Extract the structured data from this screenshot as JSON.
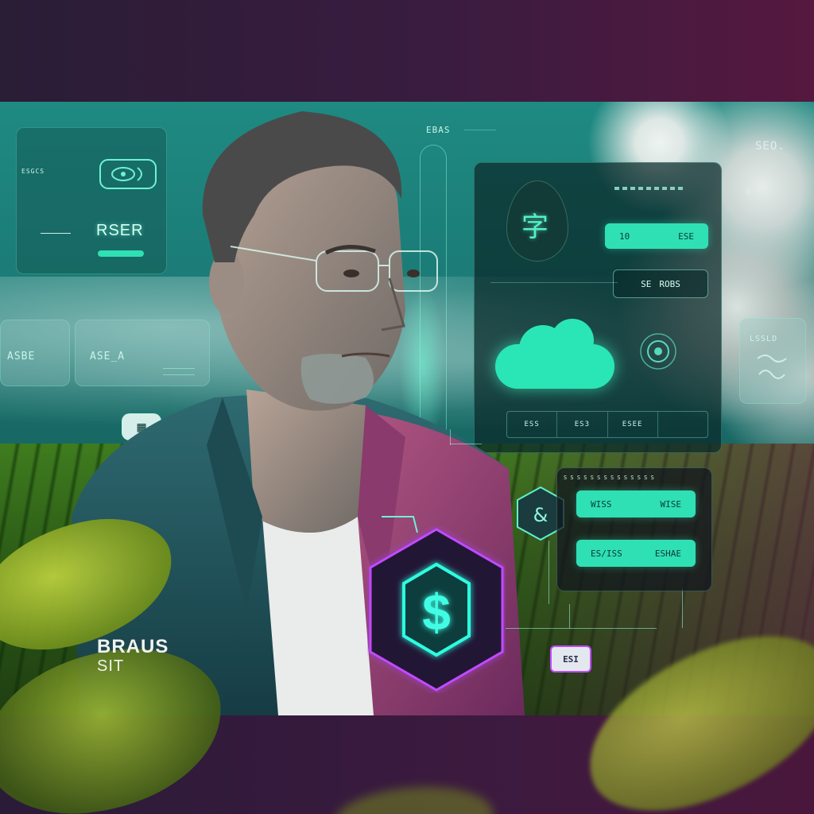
{
  "left_panel": {
    "small_label": "ESGCS",
    "title": "RSER"
  },
  "top_center_label": "EBAS",
  "right_corner_label": "SEO.",
  "right_corner_small": "0",
  "mid_left_panels": {
    "panel_a_text": "ASBE",
    "panel_b_text": "ASE_A"
  },
  "main_panel": {
    "glyph": "字",
    "pill_button": {
      "left": "10",
      "right": "ESE"
    },
    "outline_button": {
      "left": "SE",
      "right": "ROBS"
    },
    "table_cells": [
      "ESS",
      "ES3",
      "ESEE",
      ""
    ]
  },
  "right_side_panel": {
    "text": "LSSLD"
  },
  "lower_panel": {
    "header_text": "S S S S S S S S S S S S S S",
    "button_1": {
      "left": "WISS",
      "right": "WISE"
    },
    "button_2": {
      "left": "ES/ISS",
      "right": "ESHAE"
    }
  },
  "coin_symbol": "$",
  "hex_small_symbol": "&",
  "small_tag": "ESI",
  "badge_left_glyph": "▦",
  "brand": {
    "line1": "BRAUS",
    "line2": "SIT"
  },
  "colors": {
    "accent": "#2fe0b4",
    "neon_purple": "#c04cff",
    "frame_teal": "#1b7672",
    "background": "#3a1c40"
  }
}
